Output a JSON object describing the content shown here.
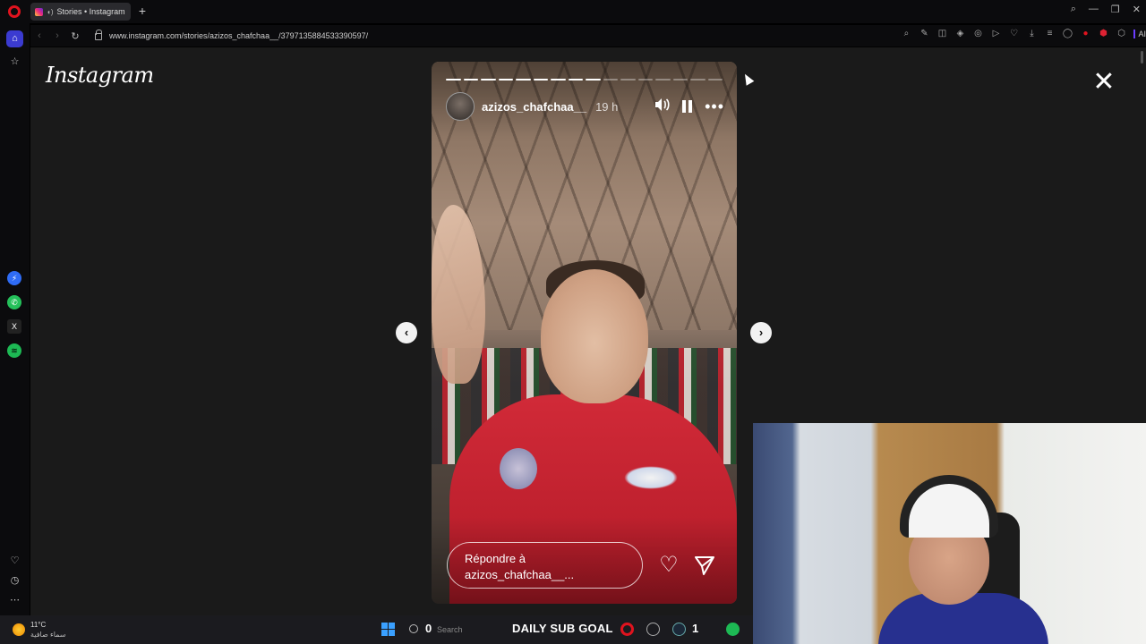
{
  "browser": {
    "tab_title": "Stories • Instagram",
    "url": "www.instagram.com/stories/azizos_chafchaa__/3797135884533390597/",
    "ai_label": "AI",
    "accent_color": "#e0131e"
  },
  "page": {
    "logo_text": "Instagram",
    "close_symbol": "✕"
  },
  "story": {
    "username": "azizos_chafchaa__",
    "time": "19 h",
    "segments_total": 16,
    "segments_done": 9,
    "reply_line1": "Répondre à",
    "reply_line2": "azizos_chafchaa__..."
  },
  "taskbar": {
    "weather_temp": "11°C",
    "weather_desc": "سماء صافية",
    "search_text": "Search",
    "goal_count": "0",
    "goal_label": "DAILY SUB GOAL",
    "goal_target": "1"
  },
  "icons": {
    "prev": "‹",
    "next": "›",
    "heart": "♡",
    "mute": "🔈",
    "more": "•••"
  }
}
